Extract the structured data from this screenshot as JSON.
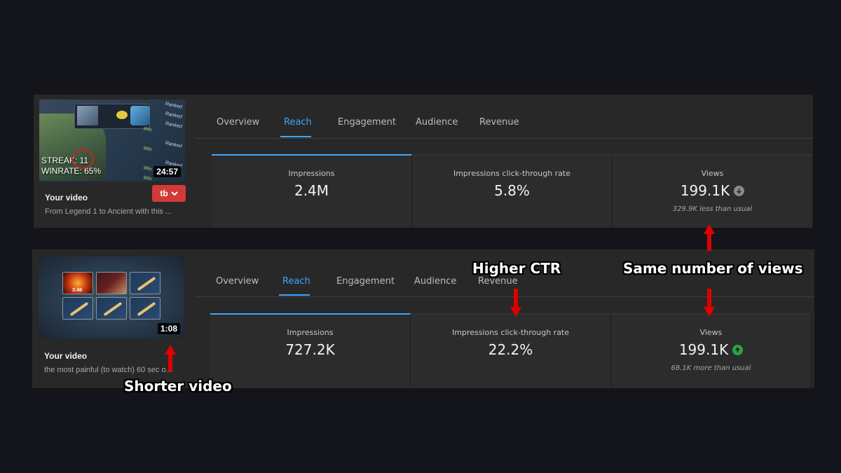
{
  "top_panel": {
    "video": {
      "duration": "24:57",
      "title": "Your video",
      "subtitle": "From Legend 1 to Ancient with this ...",
      "thumb_streak": "STREAK: 11",
      "thumb_winrate": "WINRATE: 65%",
      "thumb_list": [
        "Ranked",
        "Ranked",
        "Ranked",
        "Win",
        "Ranked",
        "Win",
        "Ranked",
        "Win",
        "Win"
      ],
      "brand_button": "tb"
    },
    "tabs": [
      "Overview",
      "Reach",
      "Engagement",
      "Audience",
      "Revenue"
    ],
    "active_tab": "Reach",
    "cards": [
      {
        "label": "Impressions",
        "value": "2.4M",
        "note": ""
      },
      {
        "label": "Impressions click-through rate",
        "value": "5.8%",
        "note": ""
      },
      {
        "label": "Views",
        "value": "199.1K",
        "note": "329.9K less than usual",
        "trend": "down"
      }
    ]
  },
  "bottom_panel": {
    "video": {
      "duration": "1:08",
      "title": "Your video",
      "subtitle": "the most painful (to watch) 60 sec o...",
      "thumb_cooldown": "3:48"
    },
    "tabs": [
      "Overview",
      "Reach",
      "Engagement",
      "Audience",
      "Revenue"
    ],
    "active_tab": "Reach",
    "cards": [
      {
        "label": "Impressions",
        "value": "727.2K",
        "note": ""
      },
      {
        "label": "Impressions click-through rate",
        "value": "22.2%",
        "note": ""
      },
      {
        "label": "Views",
        "value": "199.1K",
        "note": "68.1K more than usual",
        "trend": "up"
      }
    ]
  },
  "annotations": {
    "higher_ctr": "Higher CTR",
    "same_views": "Same number of views",
    "shorter_video": "Shorter video"
  },
  "colors": {
    "accent": "#3ea6ff",
    "annotation_arrow": "#e00000",
    "trend_up": "#2ba640",
    "trend_down": "#8a8a8a",
    "brand_button": "#d23a3a"
  }
}
